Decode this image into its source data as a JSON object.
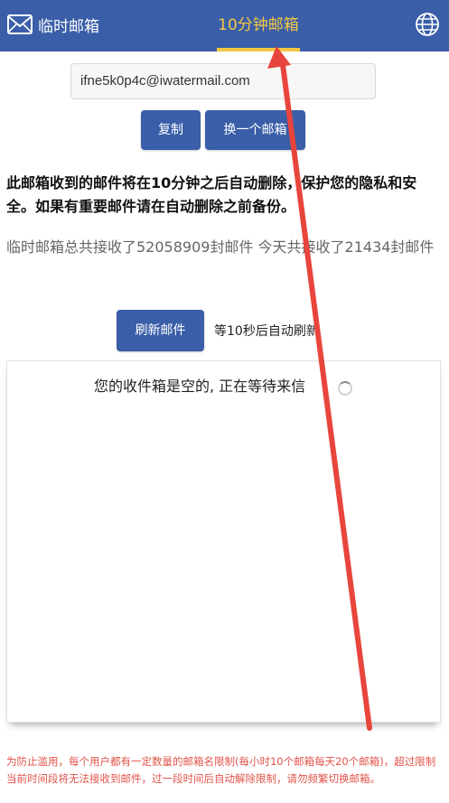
{
  "header": {
    "brand": "临时邮箱",
    "active_tab": "10分钟邮箱"
  },
  "mailbox": {
    "address": "ifne5k0p4c@iwatermail.com"
  },
  "actions": {
    "copy_label": "复制",
    "change_label": "换一个邮箱",
    "refresh_label": "刷新邮件",
    "auto_refresh_text": "等10秒后自动刷新"
  },
  "notice": "此邮箱收到的邮件将在10分钟之后自动删除，保护您的隐私和安全。如果有重要邮件请在自动删除之前备份。",
  "stats": "临时邮箱总共接收了52058909封邮件 今天共接收了21434封邮件",
  "inbox": {
    "empty_text": "您的收件箱是空的, 正在等待来信"
  },
  "warning": "为防止滥用，每个用户都有一定数量的邮箱名限制(每小时10个邮箱每天20个邮箱)，超过限制当前时间段将无法接收到邮件，过一段时间后自动解除限制，请勿频繁切换邮箱。",
  "colors": {
    "header_bg": "#3a5ea8",
    "active_tab": "#f5c842",
    "button_bg": "#3a5ea8",
    "warning_text": "#e0534a",
    "annotation_arrow": "#e8453c"
  },
  "icons": {
    "brand": "envelope-icon",
    "language": "globe-icon",
    "loading": "spinner-icon",
    "annotation": "red-arrow"
  }
}
